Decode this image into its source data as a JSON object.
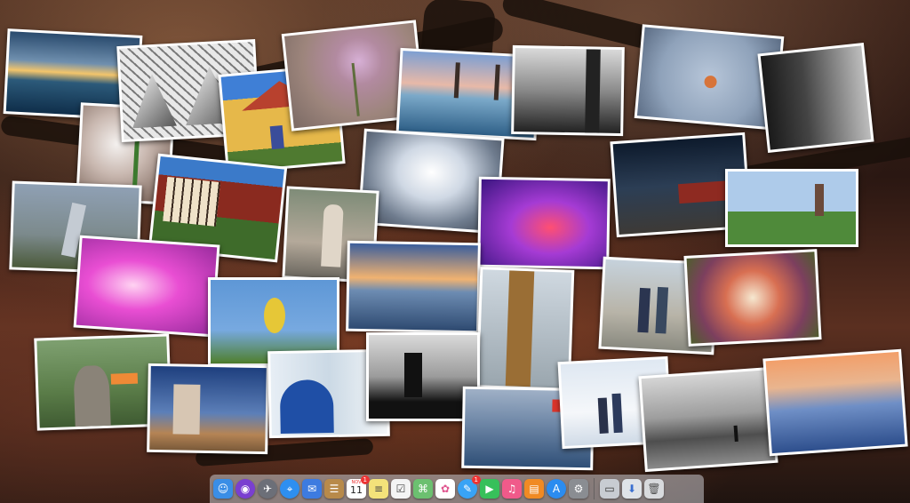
{
  "desktop": {
    "wallpaper": "tree-silhouette-sunset",
    "photos": [
      {
        "name": "photo-sea-sunrise-clouds"
      },
      {
        "name": "photo-glass-architecture"
      },
      {
        "name": "photo-yellow-house"
      },
      {
        "name": "photo-pink-flower"
      },
      {
        "name": "photo-pier-sea"
      },
      {
        "name": "photo-bw-tulips"
      },
      {
        "name": "photo-robin-bird"
      },
      {
        "name": "photo-bw-train"
      },
      {
        "name": "photo-snowdrop"
      },
      {
        "name": "photo-half-timbered-houses"
      },
      {
        "name": "photo-escalator-tunnel"
      },
      {
        "name": "photo-purple-room"
      },
      {
        "name": "photo-train-station-night"
      },
      {
        "name": "photo-church-park"
      },
      {
        "name": "photo-heron"
      },
      {
        "name": "photo-woman-bicycle"
      },
      {
        "name": "photo-sunset-beach"
      },
      {
        "name": "photo-pink-tunnel"
      },
      {
        "name": "photo-yellowhammer-bird"
      },
      {
        "name": "photo-ship-mast"
      },
      {
        "name": "photo-couple-walking"
      },
      {
        "name": "photo-food-dish"
      },
      {
        "name": "photo-goose"
      },
      {
        "name": "photo-bw-windmill"
      },
      {
        "name": "photo-ruined-church"
      },
      {
        "name": "photo-peacock"
      },
      {
        "name": "photo-kitesurfer"
      },
      {
        "name": "photo-snow-walkers"
      },
      {
        "name": "photo-bw-beach-person"
      },
      {
        "name": "photo-beach-dusk"
      }
    ]
  },
  "dock": {
    "items": [
      {
        "id": "finder",
        "color": "#3a8ee6",
        "glyph": "☺"
      },
      {
        "id": "siri",
        "color": "#7a3fd0",
        "glyph": "◉"
      },
      {
        "id": "launchpad",
        "color": "#6c6f78",
        "glyph": "✈"
      },
      {
        "id": "safari",
        "color": "#2e8ff0",
        "glyph": "⌖"
      },
      {
        "id": "mail",
        "color": "#3d7be0",
        "glyph": "✉"
      },
      {
        "id": "contacts",
        "color": "#b88a4a",
        "glyph": "☰"
      },
      {
        "id": "calendar",
        "color": "#ffffff",
        "month": "NOV",
        "day": "11",
        "badge": "1"
      },
      {
        "id": "notes",
        "color": "#f3e27a",
        "glyph": "≡"
      },
      {
        "id": "reminders",
        "color": "#f4f4f4",
        "glyph": "☑"
      },
      {
        "id": "maps",
        "color": "#6cc070",
        "glyph": "⌘"
      },
      {
        "id": "photos",
        "color": "#ffffff",
        "glyph": "✿"
      },
      {
        "id": "messages",
        "color": "#38a3f5",
        "glyph": "✎",
        "badge": "1"
      },
      {
        "id": "facetime",
        "color": "#37c05a",
        "glyph": "▶"
      },
      {
        "id": "itunes",
        "color": "#f05a8a",
        "glyph": "♫"
      },
      {
        "id": "ibooks",
        "color": "#f08a24",
        "glyph": "▤"
      },
      {
        "id": "app-store",
        "color": "#2b8cf0",
        "glyph": "A"
      },
      {
        "id": "system-preferences",
        "color": "#8a8d92",
        "glyph": "⚙"
      },
      {
        "id": "desktop-folder",
        "color": "#c8ccd2",
        "glyph": "▭"
      },
      {
        "id": "downloads",
        "color": "#dfe3e8",
        "glyph": "⬇"
      },
      {
        "id": "trash",
        "color": "#d8dadd",
        "glyph": "🗑"
      }
    ]
  }
}
